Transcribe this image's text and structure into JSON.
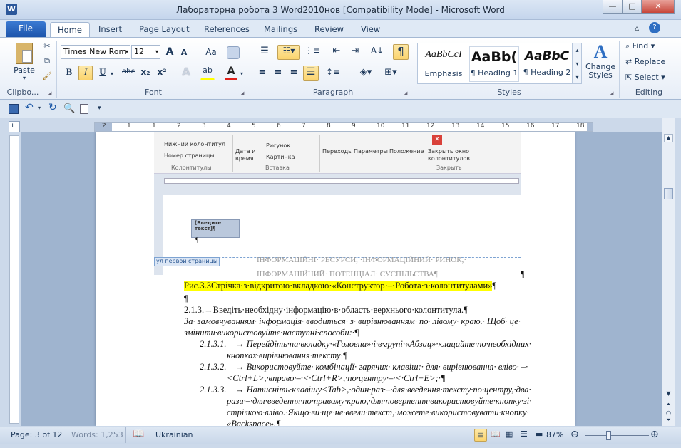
{
  "window": {
    "title": "Лабораторна робота 3 Word2010нов [Compatibility Mode]  -  Microsoft Word",
    "app_icon": "W"
  },
  "tabs": {
    "file": "File",
    "home": "Home",
    "insert": "Insert",
    "page_layout": "Page Layout",
    "references": "References",
    "mailings": "Mailings",
    "review": "Review",
    "view": "View"
  },
  "ribbon": {
    "clipboard": {
      "label": "Clipbo...",
      "paste": "Paste"
    },
    "font": {
      "label": "Font",
      "name": "Times New Rom",
      "size": "12",
      "bold": "B",
      "italic": "I",
      "underline": "U",
      "strike": "abc",
      "sub": "x₂",
      "sup": "x²",
      "grow": "A",
      "shrink": "A",
      "case": "Aa"
    },
    "paragraph": {
      "label": "Paragraph",
      "pilcrow": "¶"
    },
    "styles": {
      "label": "Styles",
      "s1_sample": "AaBbCcI",
      "s1_name": "Emphasis",
      "s2_sample": "AaBb(",
      "s2_name": "¶ Heading 1",
      "s3_sample": "AaBbC",
      "s3_name": "¶ Heading 2",
      "change_styles": "Change Styles"
    },
    "editing": {
      "label": "Editing",
      "find": "Find",
      "replace": "Replace",
      "select": "Select"
    }
  },
  "ruler": {
    "ticks": [
      "2",
      "1",
      "1",
      "2",
      "3",
      "4",
      "5",
      "6",
      "7",
      "8",
      "9",
      "10",
      "11",
      "12",
      "13",
      "14",
      "15",
      "16",
      "17",
      "18"
    ]
  },
  "embedded": {
    "ribbon_items": {
      "footer": "Нижний колонтитул",
      "page_number": "Номер страницы",
      "group1": "Колонтитулы",
      "datetime": "Дата и время",
      "picture": "Рисунок",
      "clipart": "Картинка",
      "group2": "Вставка",
      "transitions": "Переходы",
      "params": "Параметры",
      "position": "Положение",
      "close": "Закрыть окно колонтитулов",
      "group3": "Закрыть"
    },
    "header_field": "[Введите текст]¶",
    "pilcrow": "¶",
    "first_page_label": "ул первой страницы",
    "gray_line1": "ІНФОРМАЦІЙНІ· РЕСУРСИ, ·ІНФОРМАЦІЙНИЙ· РИНОК,·",
    "gray_line2": "ІНФОРМАЦІЙНИЙ· ПОТЕНЦІАЛ· СУСПІЛЬСТВА¶"
  },
  "document": {
    "caption": "Рис.3.3Стрічка·з·відкритою·вкладкою·«Конструктор·–·Робота·з·колонтитулами»",
    "caption_end": "¶",
    "pilcrow_right": "¶",
    "blank": "¶",
    "heading": "2.1.3.→Введіть·необхідну·інформацію·в·область·верхнього·колонтитула.¶",
    "intro1": "За· замовчуванням· інформація· вводиться· з· вирівнюванням· по· лівому· краю.· Щоб· це·",
    "intro2": "змінити·використовуйте·наступні·способи:·¶",
    "i1_num": "2.1.3.1.",
    "i1_a": "→ Перейдіть·на·вкладку·«Головна»·і·в·групі·«Абзац»·клацайте·по·необхідних·",
    "i1_b": "кнопках·вирівнювання·тексту·¶",
    "i2_num": "2.1.3.2.",
    "i2_a": "→ Використовуйте· комбінації· гарячих· клавіш:· для· вирівнювання· вліво· –·",
    "i2_b": "<Ctrl+L>,·вправо·–·<·Ctrl+R>,·по·центру·–·<·Ctrl+E>;·¶",
    "i3_num": "2.1.3.3.",
    "i3_a": "→ Натисніть·клавішу<Tab>,·один·раз·–·для·введення·тексту·по·центру,·два·",
    "i3_b": "рази·–·для·введення·по·правому·краю,·для·повернення·використовуйте·кнопку·зі·",
    "i3_c": "стрілкою·вліво.·Якщо·ви·ще·не·ввели·текст,·можете·використовувати·кнопку·",
    "i3_d": "«Backspace».¶"
  },
  "status": {
    "page": "Page: 3 of 12",
    "words": "Words: 1,253",
    "language": "Ukrainian",
    "zoom": "87%"
  },
  "colors": {
    "highlight": "#ffff00",
    "accent": "#2b579a"
  }
}
